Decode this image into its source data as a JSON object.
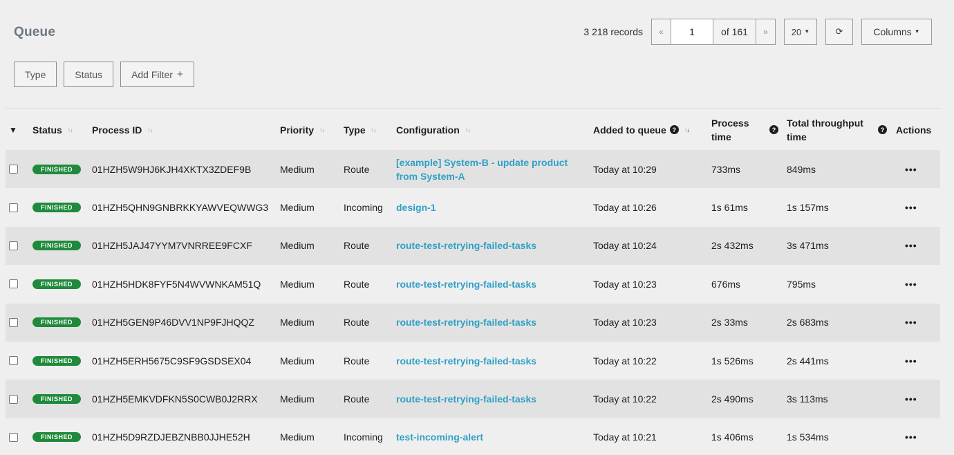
{
  "page_title": "Queue",
  "toolbar": {
    "records": "3 218 records",
    "prev": "«",
    "page": "1",
    "of_pages": "of 161",
    "next": "»",
    "page_size": "20",
    "refresh_icon": "⟳",
    "columns": "Columns"
  },
  "filters": {
    "type": "Type",
    "status": "Status",
    "add_filter": "Add Filter"
  },
  "columns": {
    "status": "Status",
    "process_id": "Process ID",
    "priority": "Priority",
    "type": "Type",
    "configuration": "Configuration",
    "added_to_queue": "Added to queue",
    "process_time_1": "Process",
    "process_time_2": "time",
    "total_throughput_1": "Total throughput",
    "total_throughput_2": "time",
    "actions": "Actions"
  },
  "rows": [
    {
      "status": "FINISHED",
      "process_id": "01HZH5W9HJ6KJH4XKTX3ZDEF9B",
      "priority": "Medium",
      "type": "Route",
      "config": "[example] System-B - update product from System-A",
      "added": "Today at 10:29",
      "process_time": "733ms",
      "total_time": "849ms"
    },
    {
      "status": "FINISHED",
      "process_id": "01HZH5QHN9GNBRKKYAWVEQWWG3",
      "priority": "Medium",
      "type": "Incoming",
      "config": "design-1",
      "added": "Today at 10:26",
      "process_time": "1s 61ms",
      "total_time": "1s 157ms"
    },
    {
      "status": "FINISHED",
      "process_id": "01HZH5JAJ47YYM7VNRREE9FCXF",
      "priority": "Medium",
      "type": "Route",
      "config": "route-test-retrying-failed-tasks",
      "added": "Today at 10:24",
      "process_time": "2s 432ms",
      "total_time": "3s 471ms"
    },
    {
      "status": "FINISHED",
      "process_id": "01HZH5HDK8FYF5N4WVWNKAM51Q",
      "priority": "Medium",
      "type": "Route",
      "config": "route-test-retrying-failed-tasks",
      "added": "Today at 10:23",
      "process_time": "676ms",
      "total_time": "795ms"
    },
    {
      "status": "FINISHED",
      "process_id": "01HZH5GEN9P46DVV1NP9FJHQQZ",
      "priority": "Medium",
      "type": "Route",
      "config": "route-test-retrying-failed-tasks",
      "added": "Today at 10:23",
      "process_time": "2s 33ms",
      "total_time": "2s 683ms"
    },
    {
      "status": "FINISHED",
      "process_id": "01HZH5ERH5675C9SF9GSDSEX04",
      "priority": "Medium",
      "type": "Route",
      "config": "route-test-retrying-failed-tasks",
      "added": "Today at 10:22",
      "process_time": "1s 526ms",
      "total_time": "2s 441ms"
    },
    {
      "status": "FINISHED",
      "process_id": "01HZH5EMKVDFKN5S0CWB0J2RRX",
      "priority": "Medium",
      "type": "Route",
      "config": "route-test-retrying-failed-tasks",
      "added": "Today at 10:22",
      "process_time": "2s 490ms",
      "total_time": "3s 113ms"
    },
    {
      "status": "FINISHED",
      "process_id": "01HZH5D9RZDJEBZNBB0JJHE52H",
      "priority": "Medium",
      "type": "Incoming",
      "config": "test-incoming-alert",
      "added": "Today at 10:21",
      "process_time": "1s 406ms",
      "total_time": "1s 534ms"
    }
  ],
  "colors": {
    "accent_link": "#2fa0c6",
    "finished_badge": "#1f8a3b",
    "row_alt": "#e2e2e2",
    "background": "#efefef"
  }
}
